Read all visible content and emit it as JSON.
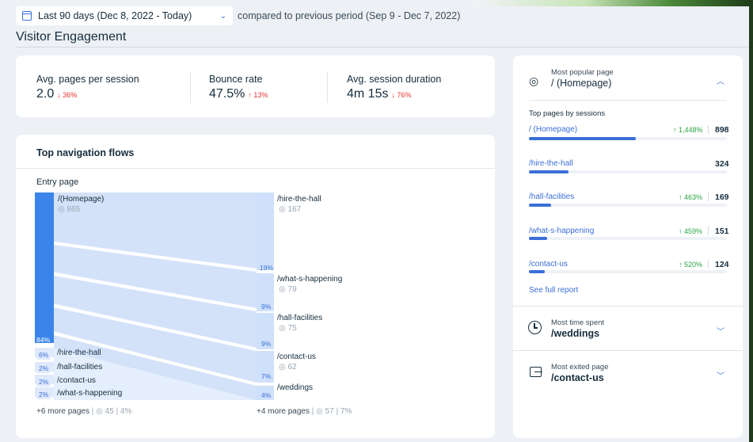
{
  "filters": {
    "date_range": "Last 90 days (Dec 8, 2022 - Today)",
    "comparison": "compared to previous period (Sep 9 - Dec 7, 2022)"
  },
  "page_title": "Visitor Engagement",
  "metrics": [
    {
      "label": "Avg. pages per session",
      "value": "2.0",
      "delta": "↓ 36%"
    },
    {
      "label": "Bounce rate",
      "value": "47.5%",
      "delta": "↑ 13%"
    },
    {
      "label": "Avg. session duration",
      "value": "4m 15s",
      "delta": "↓ 76%"
    }
  ],
  "flows": {
    "title": "Top navigation flows",
    "entry_label": "Entry page",
    "entry": {
      "name": "/(Homepage)",
      "views": "865",
      "pct": "84%"
    },
    "entry_others": [
      {
        "name": "/hire-the-hall",
        "pct": "6%"
      },
      {
        "name": "/hall-facilities",
        "pct": "2%"
      },
      {
        "name": "/contact-us",
        "pct": "2%"
      },
      {
        "name": "/what-s-happening",
        "pct": "2%"
      }
    ],
    "entry_more": {
      "label": "+6 more pages",
      "views": "45",
      "pct": "4%"
    },
    "next": [
      {
        "name": "/hire-the-hall",
        "views": "167",
        "pct": "19%"
      },
      {
        "name": "/what-s-happening",
        "views": "79",
        "pct": "9%"
      },
      {
        "name": "/hall-facilities",
        "views": "75",
        "pct": "9%"
      },
      {
        "name": "/contact-us",
        "views": "62",
        "pct": "7%"
      },
      {
        "name": "/weddings",
        "views": "",
        "pct": "4%"
      }
    ],
    "next_more": {
      "label": "+4 more pages",
      "views": "57",
      "pct": "7%"
    }
  },
  "popular": {
    "heading": "Most popular page",
    "page": "/ (Homepage)",
    "sub_heading": "Top pages by sessions",
    "pages": [
      {
        "name": "/ (Homepage)",
        "change": "↑ 1,448%",
        "count": "898",
        "fill": 0.54
      },
      {
        "name": "/hire-the-hall",
        "change": "",
        "count": "324",
        "fill": 0.2
      },
      {
        "name": "/hall-facilities",
        "change": "↑ 463%",
        "count": "169",
        "fill": 0.11
      },
      {
        "name": "/what-s-happening",
        "change": "↑ 459%",
        "count": "151",
        "fill": 0.09
      },
      {
        "name": "/contact-us",
        "change": "↑ 520%",
        "count": "124",
        "fill": 0.08
      }
    ],
    "see_full": "See full report"
  },
  "time_spent": {
    "heading": "Most time spent",
    "page": "/weddings"
  },
  "exited": {
    "heading": "Most exited page",
    "page": "/contact-us"
  },
  "colors": {
    "accent": "#3b6fd8",
    "up": "#2aa343",
    "down": "#e0342d"
  }
}
